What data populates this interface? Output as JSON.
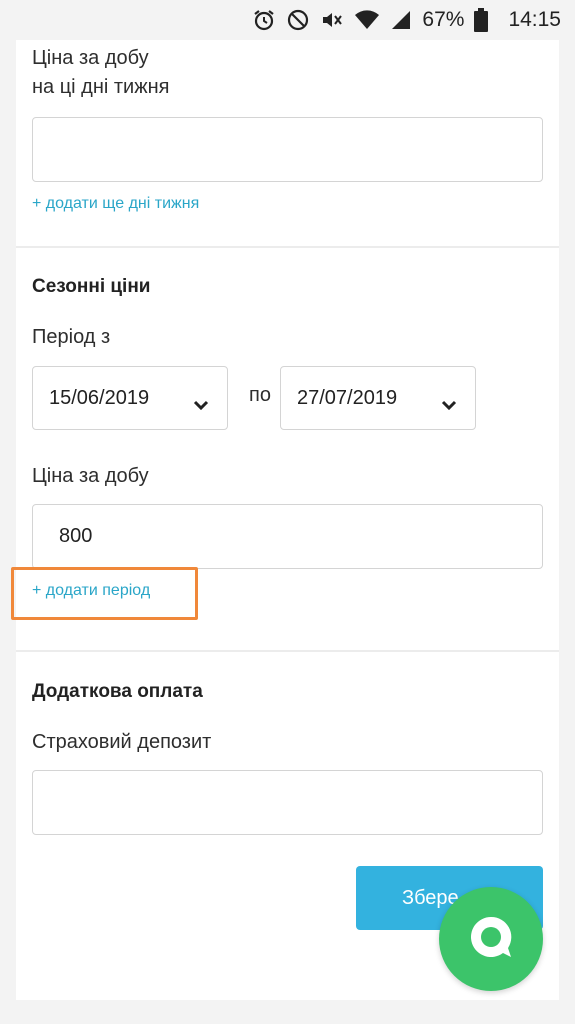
{
  "status_bar": {
    "battery": "67%",
    "time": "14:15"
  },
  "weekday_price": {
    "label_line1": "Ціна за добу",
    "label_line2": "на ці дні тижня",
    "value": "",
    "add_days_link": "+ додати ще дні тижня"
  },
  "seasonal": {
    "heading": "Сезонні ціни",
    "period_label": "Період з",
    "date_from": "15/06/2019",
    "to_label": "по",
    "date_to": "27/07/2019",
    "price_label": "Ціна за добу",
    "price_value": "800",
    "add_period_link": "+ додати період"
  },
  "extra_payment": {
    "heading": "Додаткова оплата",
    "deposit_label": "Страховий депозит",
    "deposit_value": ""
  },
  "save_button": {
    "label": "Збере"
  },
  "colors": {
    "accent": "#33b2df",
    "link": "#2aa6c8",
    "chat": "#3cc46a",
    "highlight": "#f0883a"
  },
  "icons": [
    "alarm-icon",
    "do-not-disturb-icon",
    "mute-icon",
    "wifi-icon",
    "signal-icon",
    "battery-icon",
    "chevron-down-icon",
    "chat-icon"
  ]
}
